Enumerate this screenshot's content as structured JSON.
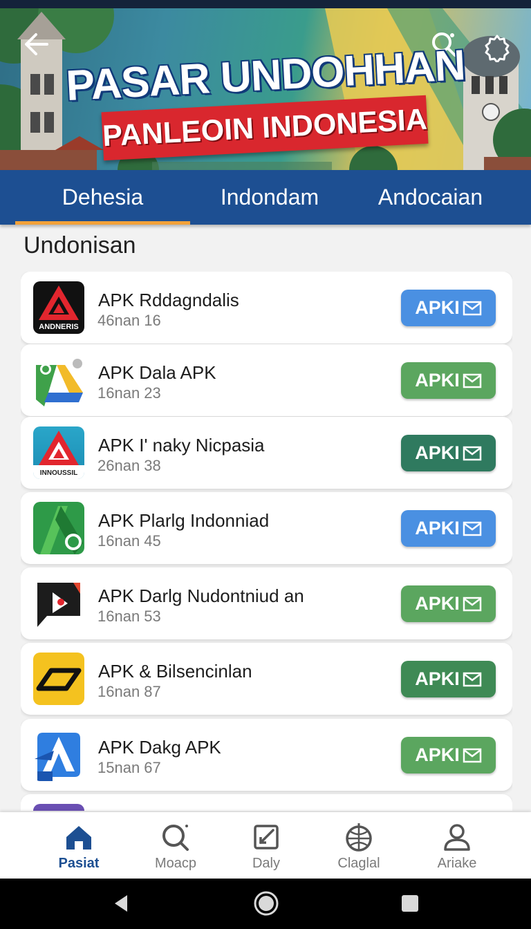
{
  "header": {
    "title": "PASAR UNDOHHAN",
    "subtitle": "PANLEOIN INDONESIA"
  },
  "icons": {
    "back": "back-arrow-icon",
    "search": "search-icon",
    "settings": "gear-icon"
  },
  "tabs": [
    {
      "label": "Dehesia",
      "active": true
    },
    {
      "label": "Indondam",
      "active": false
    },
    {
      "label": "Andocaian",
      "active": false
    }
  ],
  "section": {
    "title": "Undonisan"
  },
  "apps": [
    {
      "name": "APK Rddagndalis",
      "meta": "46nan 16",
      "icon_text": "ANDNERIS",
      "button": "APKI",
      "button_color": "#4a90e2"
    },
    {
      "name": "APK Dala APK",
      "meta": "16nan 23",
      "icon_text": "",
      "button": "APKI",
      "button_color": "#5ba65f"
    },
    {
      "name": "APK I' naky Nicpasia",
      "meta": "26nan 38",
      "icon_text": "INNOUSSIL",
      "button": "APKI",
      "button_color": "#2f7a5f"
    },
    {
      "name": "APK Plarlg Indonniad",
      "meta": "16nan 45",
      "icon_text": "",
      "button": "APKI",
      "button_color": "#4a90e2"
    },
    {
      "name": "APK Darlg Nudontniud an",
      "meta": "16nan 53",
      "icon_text": "",
      "button": "APKI",
      "button_color": "#5ba65f"
    },
    {
      "name": "APK & Bilsencinlan",
      "meta": "16nan 87",
      "icon_text": "",
      "button": "APKI",
      "button_color": "#3f8a55"
    },
    {
      "name": "APK Dakg APK",
      "meta": "15nan 67",
      "icon_text": "",
      "button": "APKI",
      "button_color": "#5ba65f"
    }
  ],
  "bottom_nav": [
    {
      "label": "Pasiat",
      "icon": "home-icon",
      "active": true
    },
    {
      "label": "Moacp",
      "icon": "search-icon",
      "active": false
    },
    {
      "label": "Daly",
      "icon": "edit-icon",
      "active": false
    },
    {
      "label": "Claglal",
      "icon": "globe-icon",
      "active": false
    },
    {
      "label": "Ariake",
      "icon": "profile-icon",
      "active": false
    }
  ],
  "colors": {
    "tab_bar": "#1d4f92",
    "tab_underline": "#f2a23a",
    "banner_red": "#d9272e",
    "nav_active": "#1d4f92"
  }
}
